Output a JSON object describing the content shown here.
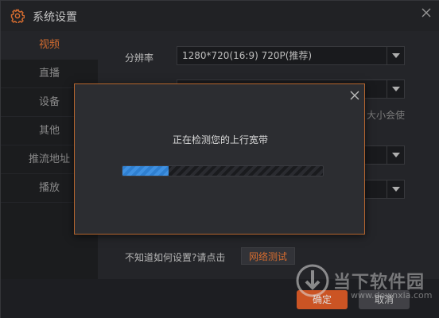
{
  "window": {
    "title": "系统设置",
    "icon": "gear-icon",
    "accent": "#f07a36"
  },
  "sidebar": {
    "items": [
      {
        "label": "视频",
        "active": true
      },
      {
        "label": "直播",
        "active": false
      },
      {
        "label": "设备",
        "active": false
      },
      {
        "label": "其他",
        "active": false
      },
      {
        "label": "推流地址",
        "active": false
      },
      {
        "label": "播放",
        "active": false
      }
    ]
  },
  "video": {
    "resolution_label": "分辨率",
    "resolution_value": "1280*720(16:9) 720P(推荐)",
    "side_hint": "大小会使"
  },
  "help": {
    "text": "不知道如何设置?请点击",
    "net_test_label": "网络测试"
  },
  "footer": {
    "ok_label": "确定",
    "cancel_label": "取消"
  },
  "watermark": {
    "brand": "当下软件园",
    "url": "www.downxia.com"
  },
  "dialog": {
    "message": "正在检测您的上行宽带",
    "progress": 0.23,
    "progress_color": "#3a8ad9"
  }
}
